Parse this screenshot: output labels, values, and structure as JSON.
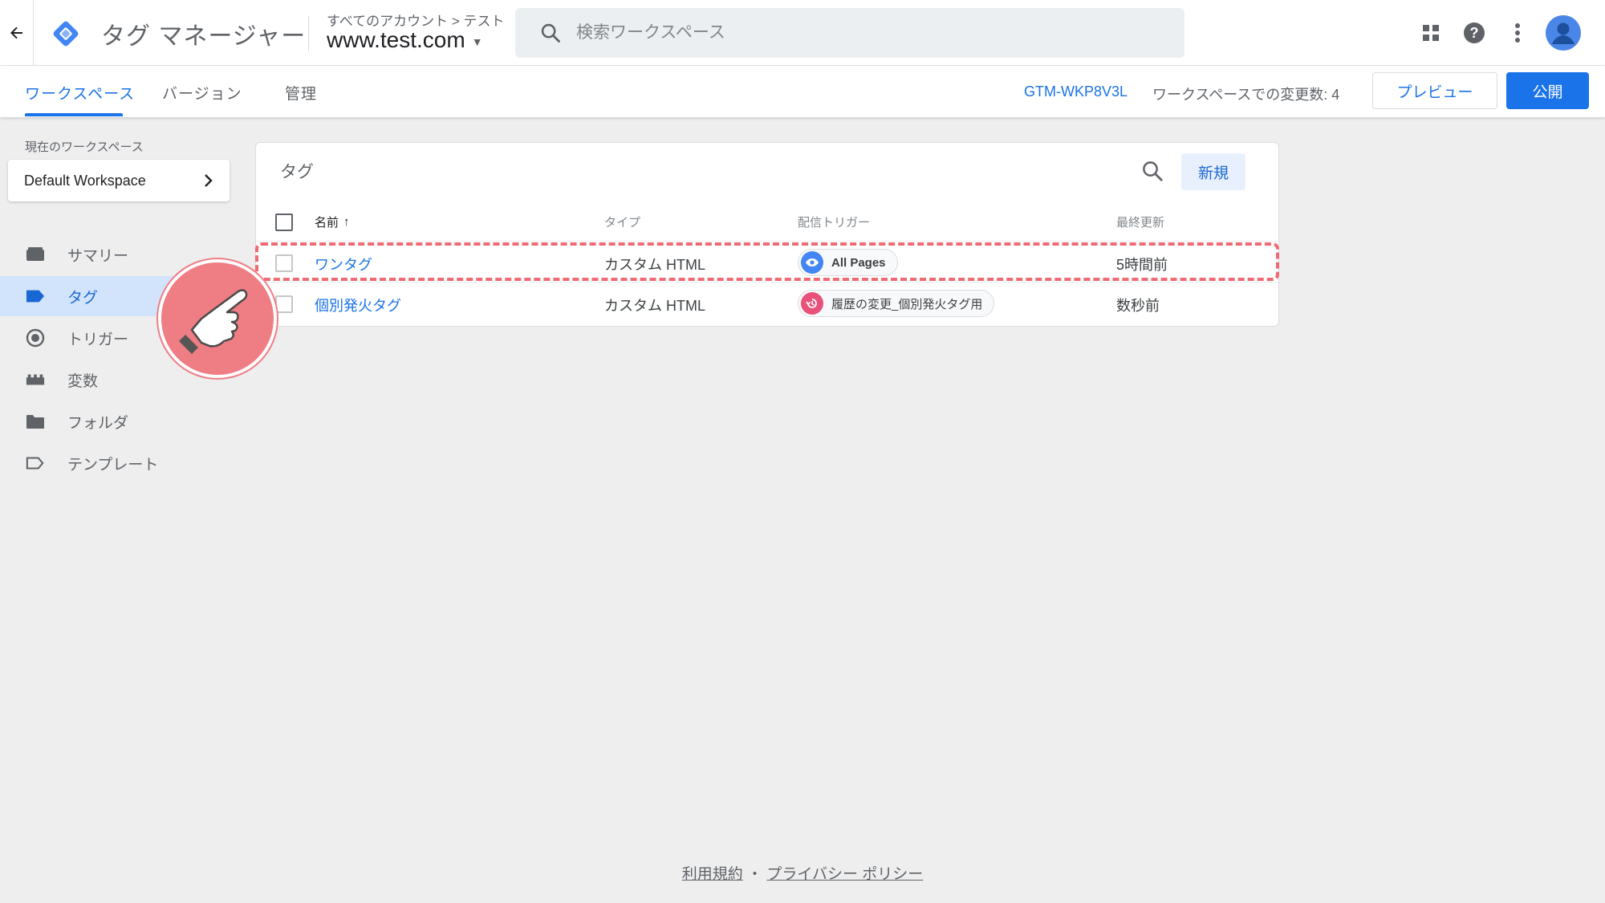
{
  "header": {
    "app_title": "タグ マネージャー",
    "breadcrumb": "すべてのアカウント > テスト",
    "account": "www.test.com",
    "search_placeholder": "検索ワークスペース"
  },
  "subnav": {
    "tabs": [
      {
        "label": "ワークスペース",
        "active": true
      },
      {
        "label": "バージョン",
        "active": false
      },
      {
        "label": "管理",
        "active": false
      }
    ],
    "container_id": "GTM-WKP8V3L",
    "changes": "ワークスペースでの変更数: 4",
    "preview_label": "プレビュー",
    "publish_label": "公開"
  },
  "sidebar": {
    "workspace_label": "現在のワークスペース",
    "workspace_name": "Default Workspace",
    "items": [
      {
        "label": "サマリー",
        "icon": "summary-icon"
      },
      {
        "label": "タグ",
        "icon": "tag-icon",
        "active": true
      },
      {
        "label": "トリガー",
        "icon": "trigger-icon"
      },
      {
        "label": "変数",
        "icon": "variable-icon"
      },
      {
        "label": "フォルダ",
        "icon": "folder-icon"
      },
      {
        "label": "テンプレート",
        "icon": "template-icon"
      }
    ]
  },
  "tags_card": {
    "title": "タグ",
    "new_label": "新規",
    "columns": [
      "名前",
      "タイプ",
      "配信トリガー",
      "最終更新"
    ],
    "rows": [
      {
        "name": "ワンタグ",
        "type": "カスタム HTML",
        "trigger": "All Pages",
        "updated": "5時間前",
        "trigger_color": "#4285f4"
      },
      {
        "name": "個別発火タグ",
        "type": "カスタム HTML",
        "trigger": "履歴の変更_個別発火タグ用",
        "updated": "数秒前",
        "trigger_color": "#e8527a"
      }
    ]
  },
  "footer": {
    "terms": "利用規約",
    "separator": "・",
    "privacy": "プライバシー ポリシー"
  }
}
